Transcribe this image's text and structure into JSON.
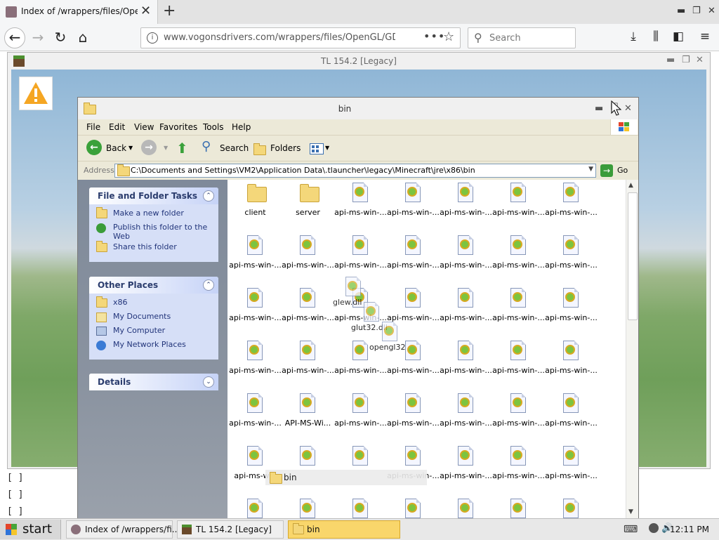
{
  "browser": {
    "tab_title": "Index of /wrappers/files/OpenGL/",
    "url": "www.vogonsdrivers.com/wrappers/files/OpenGL/GDI/Mes",
    "search_placeholder": "Search"
  },
  "page": {
    "brackets": [
      "[ ]",
      "[ ]",
      "[ ]"
    ]
  },
  "tl_window": {
    "title": "TL 154.2 [Legacy]"
  },
  "explorer": {
    "title": "bin",
    "menu": [
      "File",
      "Edit",
      "View",
      "Favorites",
      "Tools",
      "Help"
    ],
    "toolbar": {
      "back": "Back",
      "search": "Search",
      "folders": "Folders"
    },
    "address_label": "Address",
    "address_path": "C:\\Documents and Settings\\VM2\\Application Data\\.tlauncher\\legacy\\Minecraft\\jre\\x86\\bin",
    "go_label": "Go",
    "file_tasks": {
      "header": "File and Folder Tasks",
      "items": [
        "Make a new folder",
        "Publish this folder to the Web",
        "Share this folder"
      ]
    },
    "other_places": {
      "header": "Other Places",
      "items": [
        "x86",
        "My Documents",
        "My Computer",
        "My Network Places"
      ]
    },
    "details": {
      "header": "Details"
    },
    "files": [
      [
        "client",
        "server",
        "api-ms-win-...",
        "api-ms-win-...",
        "api-ms-win-...",
        "api-ms-win-...",
        "api-ms-win-..."
      ],
      [
        "api-ms-win-...",
        "api-ms-win-...",
        "api-ms-win-...",
        "api-ms-win-...",
        "api-ms-win-...",
        "api-ms-win-...",
        "api-ms-win-..."
      ],
      [
        "api-ms-win-...",
        "api-ms-win-...",
        "api-ms-win-...",
        "api-ms-win-...",
        "api-ms-win-...",
        "api-ms-win-...",
        "api-ms-win-..."
      ],
      [
        "api-ms-win-...",
        "api-ms-win-...",
        "api-ms-win-...",
        "api-ms-win-...",
        "api-ms-win-...",
        "api-ms-win-...",
        "api-ms-win-..."
      ],
      [
        "api-ms-win-...",
        "API-MS-Wi...",
        "api-ms-win-...",
        "api-ms-win-...",
        "api-ms-win-...",
        "api-ms-win-...",
        "api-ms-win-..."
      ],
      [
        "api-ms-win",
        "",
        "",
        "api-ms-win-...",
        "api-ms-win-...",
        "api-ms-win-...",
        "api-ms-win-..."
      ],
      [
        "",
        "",
        "",
        "",
        "",
        "",
        ""
      ]
    ],
    "drag_files": [
      "glew.dll",
      "glut32.dll",
      "opengl32"
    ],
    "drag_tip": "bin"
  },
  "taskbar": {
    "start": "start",
    "buttons": [
      "Index of /wrappers/fi...",
      "TL 154.2 [Legacy]",
      "bin"
    ],
    "clock": "12:11 PM"
  },
  "colors": {
    "selected_task": "#f9d66b",
    "link_blue": "#21347a"
  }
}
